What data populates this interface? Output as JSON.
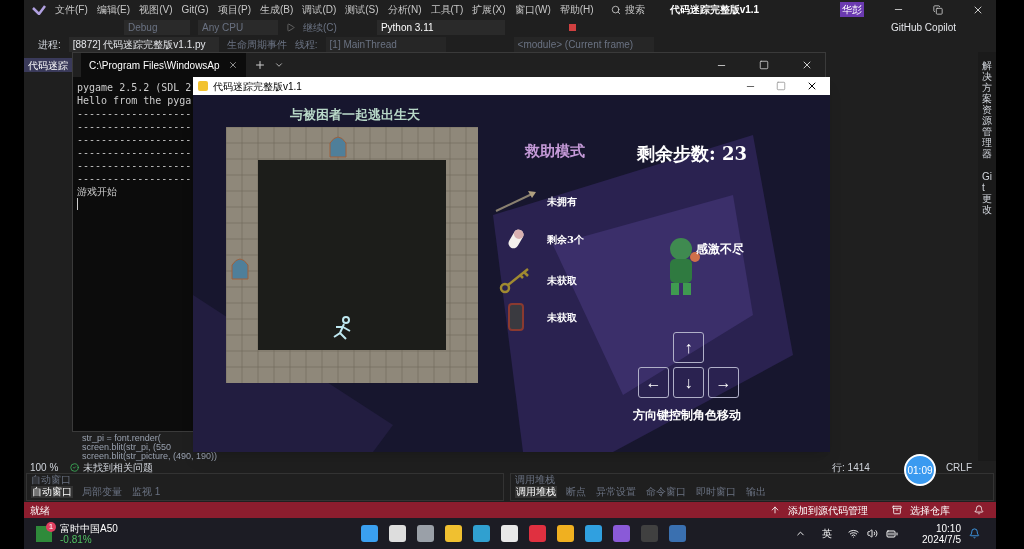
{
  "ide": {
    "menu": [
      "文件(F)",
      "编辑(E)",
      "视图(V)",
      "Git(G)",
      "项目(P)",
      "生成(B)",
      "调试(D)",
      "测试(S)",
      "分析(N)",
      "工具(T)",
      "扩展(X)",
      "窗口(W)",
      "帮助(H)"
    ],
    "search": "搜索",
    "title": "代码迷踪完整版v1.1",
    "user_badge": "华彭",
    "copilot": "GitHub Copilot",
    "toolbar": {
      "config": "Debug",
      "platform": "Any CPU",
      "continue": "继续(C)",
      "env": "Python 3.11"
    },
    "debug_bar": {
      "process_label": "进程:",
      "process": "[8872] 代码迷踪完整版v1.1.py",
      "event": "生命周期事件",
      "thread_label": "线程:",
      "thread": "[1] MainThread",
      "frame": "<module> (Current frame)"
    },
    "editor_tab": "代码迷踪",
    "code_lines": [
      "str_pi = font.render(",
      "screen.blit(str_pi, (550",
      "screen.blit(str_picture, (490, 190))"
    ],
    "status": {
      "zoom": "100 %",
      "issues": "未找到相关问题",
      "line": "行: 1414",
      "eol": "CRLF"
    },
    "side_tabs": [
      "解决方案资源管理器",
      "Git 更改"
    ]
  },
  "terminal": {
    "tab": "C:\\Program Files\\WindowsAp",
    "lines": [
      "pygame 2.5.2 (SDL 2",
      "Hello from the pyga",
      "-------------------",
      "-------------------",
      "-------------------",
      "-------------------",
      "-------------------",
      "-------------------",
      "游戏开始"
    ]
  },
  "game": {
    "title": "代码迷踪完整版v1.1",
    "heading": "与被困者一起逃出生天",
    "mode": "救助模式",
    "steps": "剩余步数: 23",
    "items": [
      {
        "kind": "weapon",
        "status": "未拥有"
      },
      {
        "kind": "pill",
        "status": "剩余3个"
      },
      {
        "kind": "key",
        "status": "未获取"
      },
      {
        "kind": "phone",
        "status": "未获取"
      }
    ],
    "speech": "感激不尽",
    "keys": [
      "↑",
      "←",
      "↓",
      "→"
    ],
    "hint": "方向键控制角色移动"
  },
  "panels": [
    {
      "title": "自动窗口",
      "tabs": [
        {
          "label": "自动窗口",
          "selected": true
        },
        {
          "label": "局部变量",
          "selected": false
        },
        {
          "label": "监视 1",
          "selected": false
        }
      ]
    },
    {
      "title": "调用堆栈",
      "tabs": [
        {
          "label": "调用堆栈",
          "selected": true
        },
        {
          "label": "断点",
          "selected": false
        },
        {
          "label": "异常设置",
          "selected": false
        },
        {
          "label": "命令窗口",
          "selected": false
        },
        {
          "label": "即时窗口",
          "selected": false
        },
        {
          "label": "输出",
          "selected": false
        }
      ]
    }
  ],
  "statusbar": {
    "ready": "就绪",
    "source_control": "添加到源代码管理",
    "repo": "选择仓库"
  },
  "taskbar": {
    "stock": {
      "badge": "1",
      "name": "富时中国A50",
      "change": "-0.81%"
    },
    "ime": "英",
    "time": "10:10",
    "date": "2024/7/5"
  },
  "timer": "01:09"
}
